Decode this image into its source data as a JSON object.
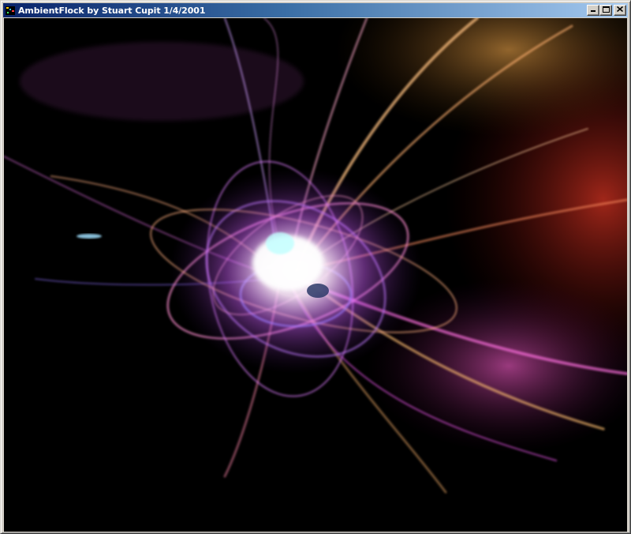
{
  "window": {
    "title": "AmbientFlock by Stuart Cupit 1/4/2001",
    "buttons": {
      "minimize_icon": "minimize-icon",
      "maximize_icon": "maximize-icon",
      "close_icon": "close-icon"
    }
  },
  "colors": {
    "titlebar_start": "#0a246a",
    "titlebar_end": "#a6caf0",
    "canvas_background": "#000000",
    "glow_core": "#ffffff",
    "glow_magenta": "#e040ff",
    "glow_gold": "#ffb060",
    "glow_red": "#c02020",
    "glow_blue": "#7090ff"
  }
}
